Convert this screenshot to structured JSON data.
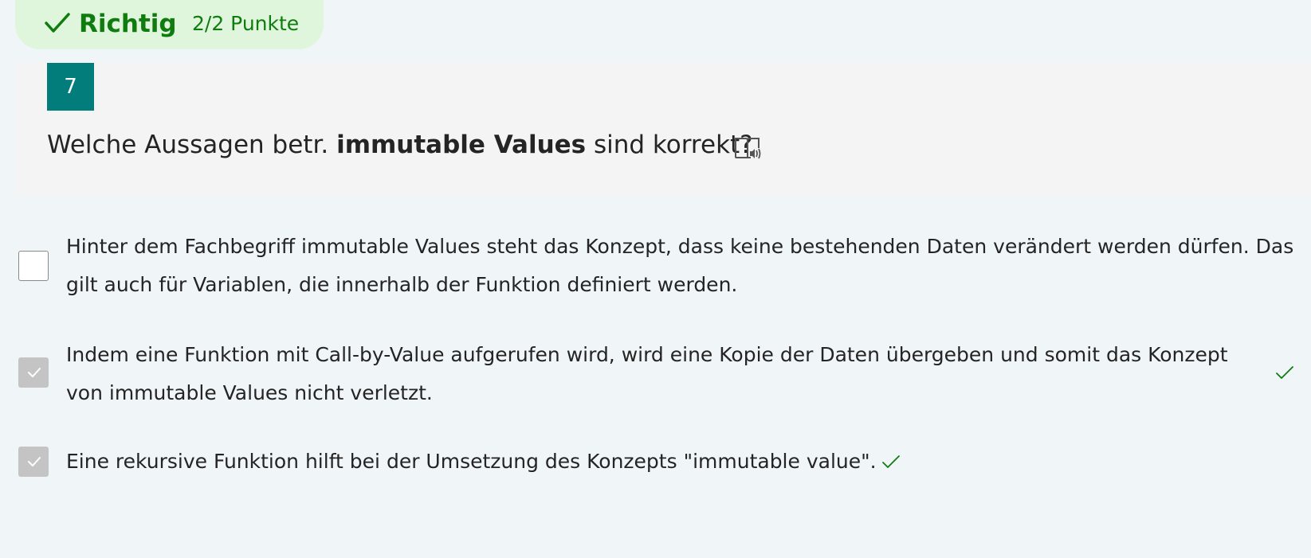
{
  "result": {
    "status": "Richtig",
    "points": "2/2 Punkte",
    "icon": "checkmark-icon",
    "color": "#107c10",
    "background": "#dff6dd"
  },
  "question": {
    "number": "7",
    "text_before": "Welche Aussagen betr. ",
    "text_bold": "immutable Values",
    "text_after": " sind korrekt?",
    "reader_icon": "immersive-reader-icon",
    "badge_color": "#037c7c"
  },
  "options": [
    {
      "line1": "Hinter dem Fachbegriff immutable Values steht das Konzept, dass keine bestehenden Daten verändert werden dürfen. Das",
      "line2": "gilt auch für Variablen, die innerhalb der Funktion definiert werden.",
      "checked": false,
      "correct_mark": false
    },
    {
      "line1": "Indem eine Funktion mit Call-by-Value aufgerufen wird, wird eine Kopie der Daten übergeben und somit das Konzept",
      "line2": "von immutable Values nicht verletzt.",
      "checked": true,
      "correct_mark": true
    },
    {
      "line1": "Eine rekursive Funktion hilft bei der Umsetzung des Konzepts \"immutable value\".",
      "line2": "",
      "checked": true,
      "correct_mark": true
    }
  ],
  "colors": {
    "page_background": "#f0f6f8",
    "card_background": "#f4f4f4",
    "correct_green": "#107c10"
  }
}
